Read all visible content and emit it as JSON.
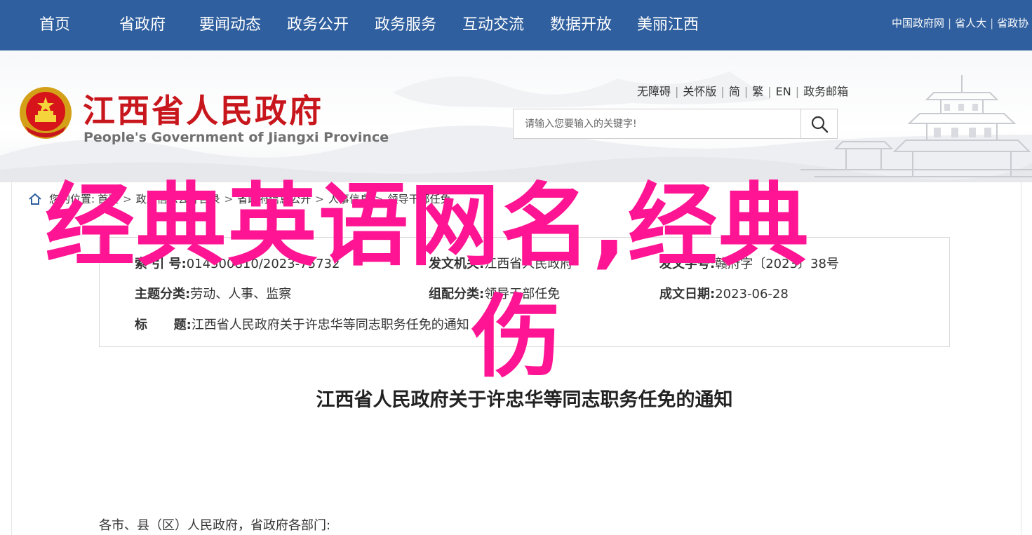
{
  "topnav": {
    "items": [
      {
        "label": "首页"
      },
      {
        "label": "省政府"
      },
      {
        "label": "要闻动态"
      },
      {
        "label": "政务公开"
      },
      {
        "label": "政务服务"
      },
      {
        "label": "互动交流"
      },
      {
        "label": "数据开放"
      },
      {
        "label": "美丽江西"
      }
    ],
    "links": [
      "中国政府网",
      "省人大",
      "省政协"
    ]
  },
  "header": {
    "title_cn": "江西省人民政府",
    "title_en": "People's Government of Jiangxi Province",
    "utility_links": [
      "无障碍",
      "关怀版",
      "简",
      "繁",
      "EN",
      "政务邮箱"
    ],
    "search_placeholder": "请输入您要输入的关键字!"
  },
  "breadcrumb": {
    "label": "您的位置:",
    "items": [
      "首页",
      "政府信息公开目录",
      "省政府信息公开",
      "人事信息",
      "领导干部任免"
    ]
  },
  "info": {
    "index_label": "索 引 号:",
    "index_value": "014500810/2023-75732",
    "issuer_label": "发文机关:",
    "issuer_value": "江西省人民政府",
    "doc_no_label": "发文字号:",
    "doc_no_value": "赣府字〔2023〕38号",
    "topic_label": "主题分类:",
    "topic_value": "劳动、人事、监察",
    "org_label": "组配分类:",
    "org_value": "领导干部任免",
    "date_label": "成文日期:",
    "date_value": "2023-06-28",
    "title_label": "标      题:",
    "title_value": "江西省人民政府关于许忠华等同志职务任免的通知"
  },
  "article": {
    "title": "江西省人民政府关于许忠华等同志职务任免的通知",
    "greeting": "各市、县（区）人民政府，省政府各部门:"
  },
  "overlay": {
    "line1": "经典英语网名,经典",
    "line2": "伤"
  },
  "colors": {
    "nav_bg": "#2f5f9e",
    "brand_red": "#c8161d",
    "overlay_pink": "#ff1493"
  }
}
